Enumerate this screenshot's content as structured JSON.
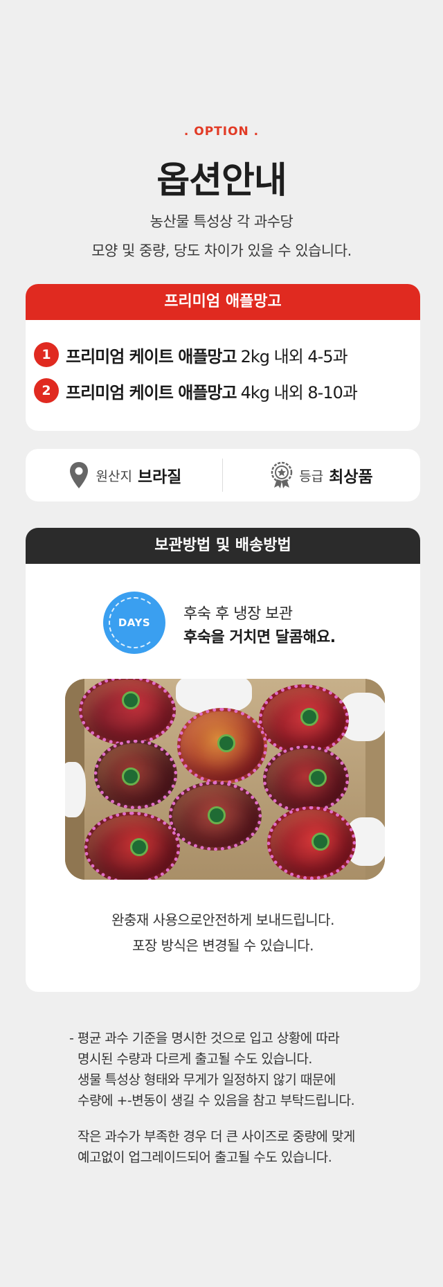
{
  "header": {
    "option_label": ". OPTION .",
    "title": "옵션안내",
    "subtitle_lines": [
      "농산물 특성상 각 과수당",
      "모양 및 중량, 당도 차이가 있을 수 있습니다."
    ]
  },
  "premium_card": {
    "heading": "프리미엄 애플망고",
    "options": [
      {
        "number": "1",
        "name": "프리미엄 케이트 애플망고",
        "weight": "2kg 내외 4-5과"
      },
      {
        "number": "2",
        "name": "프리미엄 케이트 애플망고",
        "weight": "4kg 내외 8-10과"
      }
    ]
  },
  "info_card": {
    "origin_label": "원산지",
    "origin_value": "브라질",
    "origin_icon": "location-pin-icon",
    "grade_label": "등급",
    "grade_value": "최상품",
    "grade_icon": "award-medal-icon"
  },
  "storage_card": {
    "heading": "보관방법 및 배송방법",
    "days_badge": "DAYS",
    "days_line1": "후숙 후 냉장 보관",
    "days_line2": "후숙을 거치면 달콤해요.",
    "photo_subject": "mangoes-in-box-photo",
    "text_lines": [
      "완충재 사용으로안전하게 보내드립니다.",
      "포장 방식은 변경될 수 있습니다."
    ]
  },
  "notes": {
    "paragraph1": [
      "- 평균 과수 기준을 명시한 것으로 입고 상황에 따라",
      "  명시된 수량과 다르게 출고될 수도 있습니다.",
      "  생물 특성상 형태와 무게가 일정하지 않기 때문에",
      "  수량에 +-변동이 생길 수 있음을 참고 부탁드립니다."
    ],
    "paragraph2": [
      "  작은 과수가 부족한 경우 더 큰 사이즈로 중량에 맞게",
      "  예고없이 업그레이드되어 출고될 수도 있습니다."
    ]
  },
  "colors": {
    "accent_red": "#e02a20",
    "dark_header": "#2b2b2b",
    "days_blue": "#3a9ff0",
    "background": "#efefef"
  }
}
